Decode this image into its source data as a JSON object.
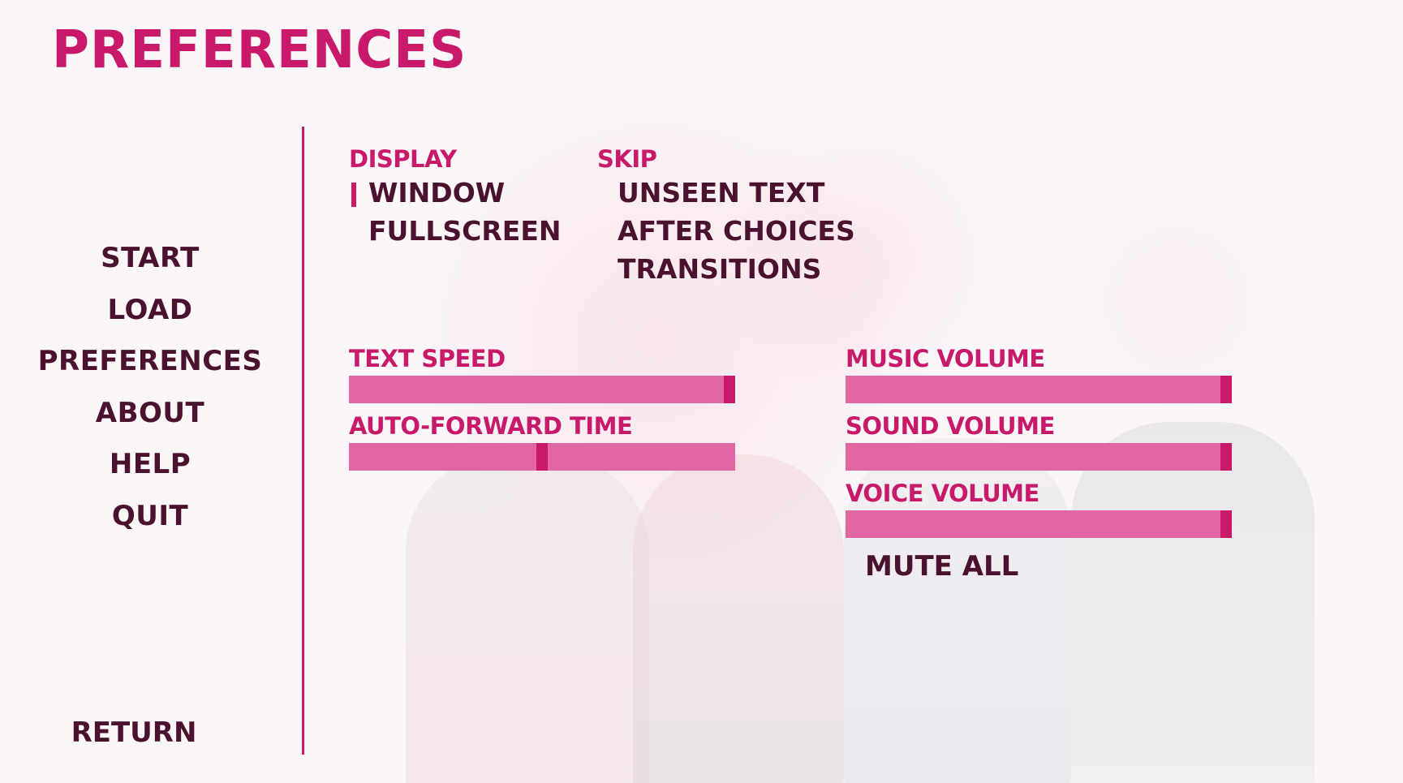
{
  "title": "PREFERENCES",
  "nav": {
    "items": [
      "START",
      "LOAD",
      "PREFERENCES",
      "ABOUT",
      "HELP",
      "QUIT"
    ],
    "return_label": "RETURN"
  },
  "display": {
    "label": "DISPLAY",
    "options": [
      "WINDOW",
      "FULLSCREEN"
    ],
    "selected": "WINDOW"
  },
  "skip": {
    "label": "SKIP",
    "options": [
      "UNSEEN TEXT",
      "AFTER CHOICES",
      "TRANSITIONS"
    ]
  },
  "sliders": {
    "text_speed": {
      "label": "TEXT SPEED",
      "fraction": 0.985
    },
    "auto_forward": {
      "label": "AUTO-FORWARD TIME",
      "fraction": 0.5
    },
    "music_volume": {
      "label": "MUSIC VOLUME",
      "fraction": 0.985
    },
    "sound_volume": {
      "label": "SOUND VOLUME",
      "fraction": 0.985
    },
    "voice_volume": {
      "label": "VOICE VOLUME",
      "fraction": 0.985
    }
  },
  "mute_all_label": "MUTE ALL",
  "colors": {
    "accent": "#c8196b",
    "text": "#4b1230",
    "slider_bar": "#e066a4",
    "background": "#fbf7f9"
  }
}
